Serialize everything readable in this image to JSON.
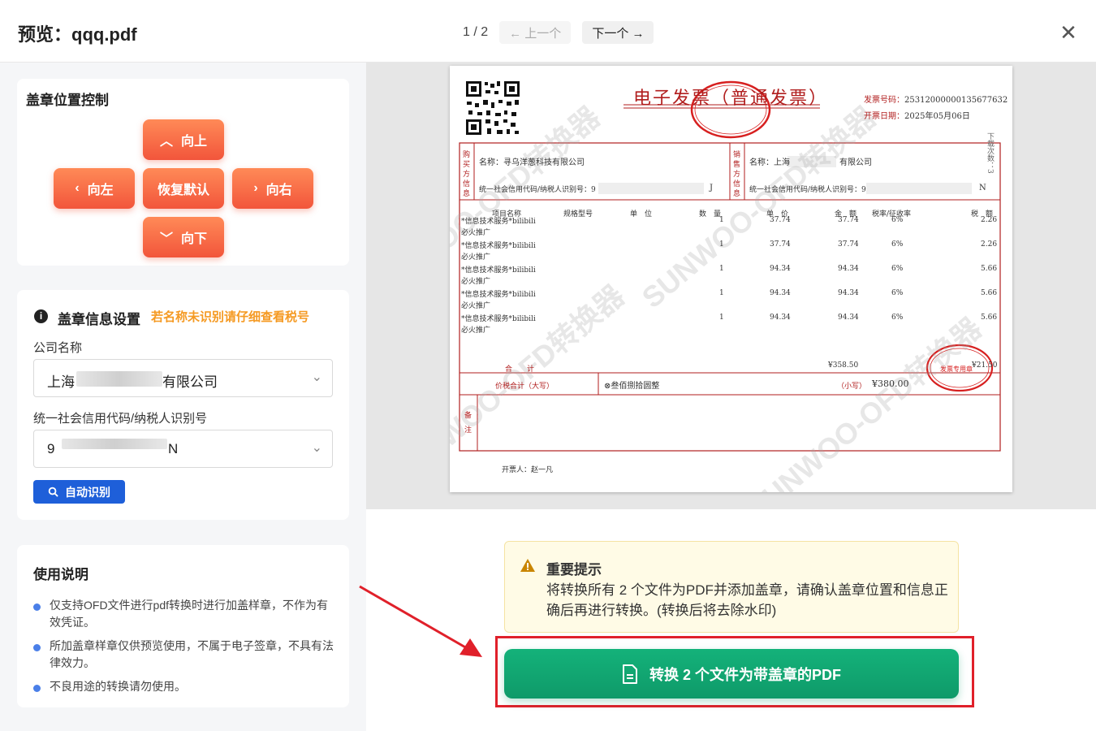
{
  "header": {
    "title": "预览：qqq.pdf",
    "page_counter": "1 / 2",
    "prev_label": "← 上一个",
    "next_label": "下一个 →",
    "close_icon": "close-icon"
  },
  "position_control": {
    "title": "盖章位置控制",
    "up": "向上",
    "left": "向左",
    "reset": "恢复默认",
    "right": "向右",
    "down": "向下"
  },
  "seal_info": {
    "title": "盖章信息设置",
    "hint": "若名称未识别请仔细查看税号",
    "company_label": "公司名称",
    "company_value_start": "上海",
    "company_value_end": "有限公司",
    "tax_label": "统一社会信用代码/纳税人识别号",
    "tax_value_start": "9",
    "tax_value_end": "N",
    "auto_button": "自动识别"
  },
  "instructions": {
    "title": "使用说明",
    "items": [
      "仅支持OFD文件进行pdf转换时进行加盖样章，不作为有效凭证。",
      "所加盖章样章仅供预览使用，不属于电子签章，不具有法律效力。",
      "不良用途的转换请勿使用。"
    ]
  },
  "invoice": {
    "title": "电子发票（普通发票）",
    "invoice_no_label": "发票号码：",
    "invoice_no": "25312000000135677632",
    "date_label": "开票日期：",
    "date": "2025年05月06日",
    "buyer_side": "购买方信息",
    "seller_side": "销售方信息",
    "buyer_name": "名称：寻乌洋葱科技有限公司",
    "buyer_tax": "统一社会信用代码/纳税人识别号：9",
    "buyer_tax_end": "J",
    "seller_name": "名称：上海",
    "seller_name_end": "有限公司",
    "seller_tax": "统一社会信用代码/纳税人识别号：9",
    "seller_tax_end": "N",
    "col_item": "项目名称",
    "col_spec": "规格型号",
    "col_unit": "单　位",
    "col_qty": "数　量",
    "col_price": "单　价",
    "col_amount": "金　额",
    "col_rate": "税率/征收率",
    "col_tax": "税　额",
    "rows": [
      {
        "name1": "*信息技术服务*bilibili",
        "name2": "必火推广",
        "qty": "1",
        "price": "37.74",
        "amount": "37.74",
        "rate": "6%",
        "tax": "2.26"
      },
      {
        "name1": "*信息技术服务*bilibili",
        "name2": "必火推广",
        "qty": "1",
        "price": "37.74",
        "amount": "37.74",
        "rate": "6%",
        "tax": "2.26"
      },
      {
        "name1": "*信息技术服务*bilibili",
        "name2": "必火推广",
        "qty": "1",
        "price": "94.34",
        "amount": "94.34",
        "rate": "6%",
        "tax": "5.66"
      },
      {
        "name1": "*信息技术服务*bilibili",
        "name2": "必火推广",
        "qty": "1",
        "price": "94.34",
        "amount": "94.34",
        "rate": "6%",
        "tax": "5.66"
      },
      {
        "name1": "*信息技术服务*bilibili",
        "name2": "必火推广",
        "qty": "1",
        "price": "94.34",
        "amount": "94.34",
        "rate": "6%",
        "tax": "5.66"
      }
    ],
    "total_label": "合　　计",
    "total_amount": "¥358.50",
    "total_tax": "¥21.50",
    "grand_label": "价税合计（大写）",
    "grand_upper": "⊗叁佰捌拾圆整",
    "grand_small_label": "（小写）",
    "grand_small": "¥380.00",
    "remark_label": "备注",
    "issuer": "开票人：赵一凡",
    "side_note": "下载次数：3",
    "stamp_text": "发票专用章",
    "watermark": "SUNWOO-OFD转换器"
  },
  "warning": {
    "title": "重要提示",
    "body": "将转换所有 2 个文件为PDF并添加盖章，请确认盖章位置和信息正确后再进行转换。(转换后将去除水印)"
  },
  "convert_button": "转换 2 个文件为带盖章的PDF",
  "colors": {
    "orange": "#f2553b",
    "blue": "#1e5fd9",
    "green": "#0f9a69",
    "red_annotation": "#e0202a"
  }
}
